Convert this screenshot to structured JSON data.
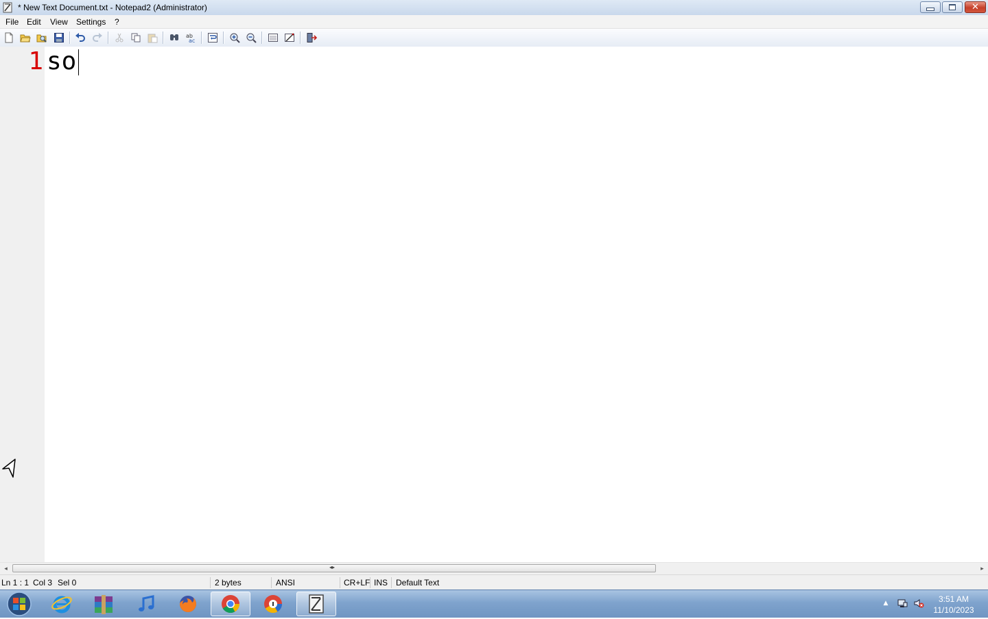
{
  "window": {
    "title": "* New Text Document.txt - Notepad2 (Administrator)",
    "close_glyph": "✕"
  },
  "menu": [
    "File",
    "Edit",
    "View",
    "Settings",
    "?"
  ],
  "toolbar": {
    "icons": [
      "new-icon",
      "open-icon",
      "browse-icon",
      "save-icon",
      "undo-icon",
      "redo-icon",
      "cut-icon",
      "copy-icon",
      "paste-icon",
      "find-icon",
      "replace-icon",
      "word-wrap-icon",
      "zoom-in-icon",
      "zoom-out-icon",
      "scheme-icon",
      "customize-scheme-icon",
      "exit-icon"
    ]
  },
  "editor": {
    "line_number": "1",
    "text": "so",
    "line_number_color": "#d80000"
  },
  "scrollbar": {
    "left_arrow": "◂",
    "right_arrow": "▸",
    "grip": "◂▸"
  },
  "status": {
    "position": "Ln 1 : 1",
    "column": "Col 3",
    "selection": "Sel 0",
    "size": "2 bytes",
    "encoding": "ANSI",
    "line_endings": "CR+LF",
    "insert_mode": "INS",
    "lexer": "Default Text"
  },
  "taskbar": {
    "apps": [
      "internet-explorer-icon",
      "winrar-icon",
      "itunes-icon",
      "firefox-icon",
      "chrome-icon",
      "chrome-alt-icon",
      "notepad2-icon"
    ],
    "active_apps": [
      "chrome-icon",
      "notepad2-icon"
    ],
    "tray": {
      "expand_glyph": "▲",
      "time": "3:51 AM",
      "date": "11/10/2023"
    }
  }
}
